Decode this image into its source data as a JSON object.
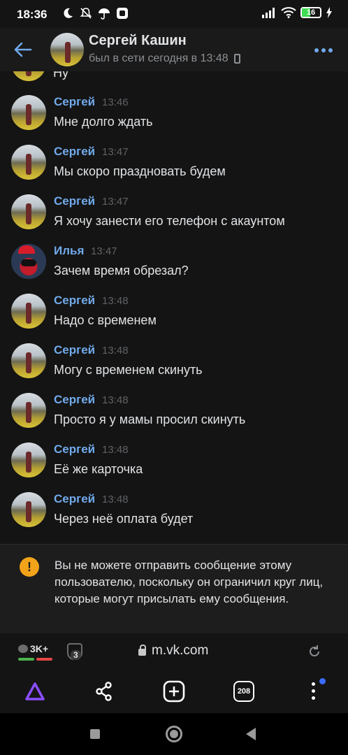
{
  "status_bar": {
    "time": "18:36",
    "battery": "16"
  },
  "header": {
    "name": "Сергей Кашин",
    "status": "был в сети сегодня в 13:48"
  },
  "partial_message": {
    "text": "Ну"
  },
  "messages": [
    {
      "author": "Сергей",
      "time": "13:46",
      "text": "Мне долго ждать",
      "avatar": "photo"
    },
    {
      "author": "Сергей",
      "time": "13:47",
      "text": "Мы скоро праздновать будем",
      "avatar": "photo"
    },
    {
      "author": "Сергей",
      "time": "13:47",
      "text": "Я хочу занести его телефон с акаунтом",
      "avatar": "photo"
    },
    {
      "author": "Илья",
      "time": "13:47",
      "text": "Зачем время обрезал?",
      "avatar": "deadpool"
    },
    {
      "author": "Сергей",
      "time": "13:48",
      "text": "Надо с временем",
      "avatar": "photo"
    },
    {
      "author": "Сергей",
      "time": "13:48",
      "text": "Могу с временем скинуть",
      "avatar": "photo"
    },
    {
      "author": "Сергей",
      "time": "13:48",
      "text": "Просто я у мамы просил скинуть",
      "avatar": "photo"
    },
    {
      "author": "Сергей",
      "time": "13:48",
      "text": "Её же карточка",
      "avatar": "photo"
    },
    {
      "author": "Сергей",
      "time": "13:48",
      "text": "Через неё оплата будет",
      "avatar": "photo"
    }
  ],
  "notice": {
    "icon": "!",
    "text": "Вы не можете отправить сообщение этому пользователю, поскольку он ограничил круг лиц, которые могут присылать ему сообщения."
  },
  "browser": {
    "counter": "3K+",
    "shield_count": "3",
    "url": "m.vk.com",
    "tabs_count": "208"
  },
  "colors": {
    "accent": "#71aaeb",
    "warning": "#f3a31a",
    "alice": "#8a4dff"
  }
}
